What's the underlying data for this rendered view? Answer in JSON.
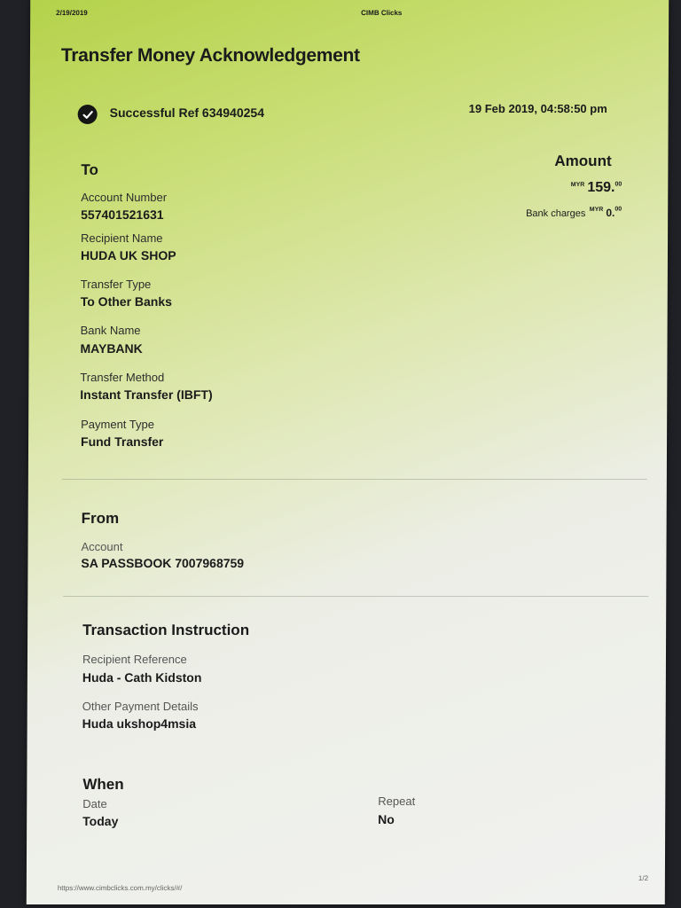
{
  "header": {
    "date": "2/19/2019",
    "site": "CIMB Clicks"
  },
  "title": "Transfer Money Acknowledgement",
  "status": {
    "text": "Successful Ref 634940254",
    "datetime": "19 Feb 2019, 04:58:50 pm"
  },
  "amount": {
    "heading": "Amount",
    "currency": "MYR",
    "value": "159.",
    "cents": "00",
    "charges_label": "Bank charges",
    "charges_currency": "MYR",
    "charges_value": "0.",
    "charges_cents": "00"
  },
  "to": {
    "heading": "To",
    "fields": [
      {
        "label": "Account Number",
        "value": "557401521631"
      },
      {
        "label": "Recipient Name",
        "value": "HUDA UK SHOP"
      },
      {
        "label": "Transfer Type",
        "value": "To Other Banks"
      },
      {
        "label": "Bank Name",
        "value": "MAYBANK"
      },
      {
        "label": "Transfer Method",
        "value": "Instant Transfer (IBFT)"
      },
      {
        "label": "Payment Type",
        "value": "Fund Transfer"
      }
    ]
  },
  "from": {
    "heading": "From",
    "account_label": "Account",
    "account_value": "SA PASSBOOK 7007968759"
  },
  "instruction": {
    "heading": "Transaction Instruction",
    "ref_label": "Recipient Reference",
    "ref_value": "Huda - Cath Kidston",
    "other_label": "Other Payment Details",
    "other_value": "Huda ukshop4msia"
  },
  "when": {
    "heading": "When",
    "date_label": "Date",
    "date_value": "Today",
    "repeat_label": "Repeat",
    "repeat_value": "No"
  },
  "footer": {
    "url": "https://www.cimbclicks.com.my/clicks/#/",
    "page": "1/2"
  }
}
